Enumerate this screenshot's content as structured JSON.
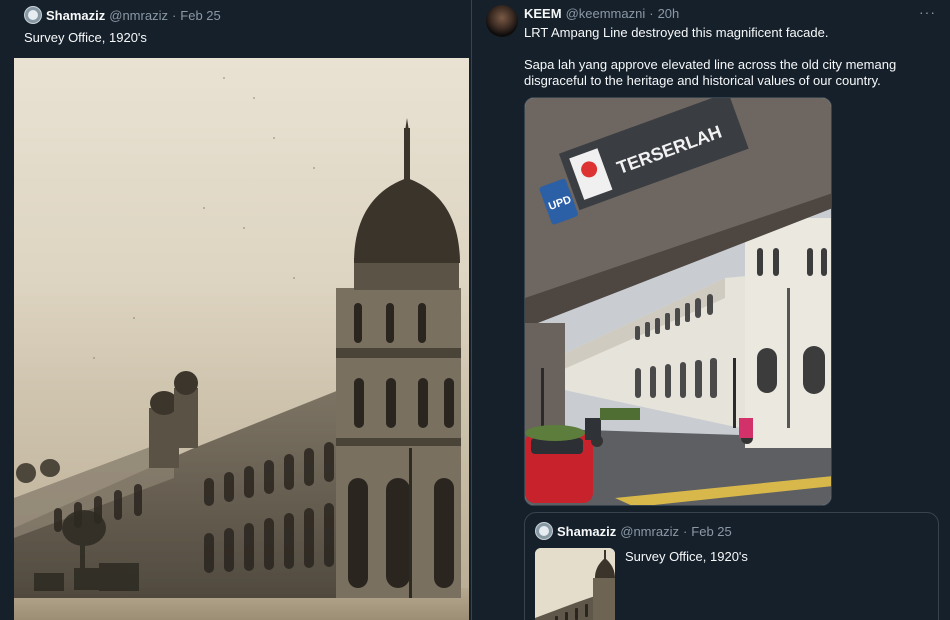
{
  "left_tweet": {
    "author_name": "Shamaziz",
    "author_handle": "@nmraziz",
    "separator": "·",
    "date": "Feb 25",
    "text": "Survey Office, 1920's",
    "image_icon": "historic-building-photo"
  },
  "right_tweet": {
    "author_name": "KEEM",
    "author_handle": "@keemmazni",
    "separator": "·",
    "time": "20h",
    "more": "···",
    "text_line1": "LRT Ampang Line destroyed this magnificent facade.",
    "text_line2": "Sapa lah yang approve elevated line across the old city memang disgraceful to the heritage and historical values of our country.",
    "photo": {
      "sign_text": "TERSERLAH",
      "station_code": "UPD"
    },
    "quote": {
      "author_name": "Shamaziz",
      "author_handle": "@nmraziz",
      "separator": "·",
      "date": "Feb 25",
      "text": "Survey Office, 1920's"
    }
  },
  "colors": {
    "background": "#15202b",
    "text_primary": "#f7f9f9",
    "text_secondary": "#8b98a5",
    "border": "#38444d"
  }
}
